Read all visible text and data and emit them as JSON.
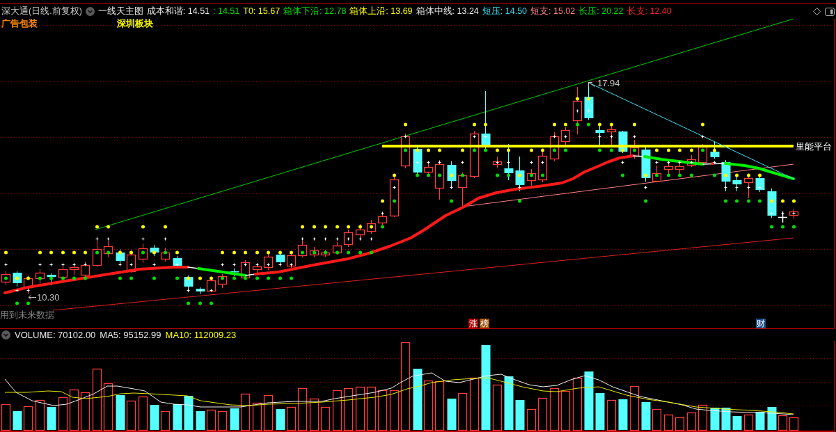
{
  "header": {
    "title": "深大通(日线.前复权)",
    "indicator": "一线天主图",
    "readings": [
      {
        "text": "成本和谐: 14.51",
        "color": "#e8e8e8"
      },
      {
        "text": ": 14.51",
        "color": "#00e000"
      },
      {
        "text": "T0: 15.67",
        "color": "#ffff00"
      },
      {
        "text": "箱体下沿: 12.78",
        "color": "#00e000"
      },
      {
        "text": "箱体上沿: 13.69",
        "color": "#ffff00"
      },
      {
        "text": "箱体中线: 13.24",
        "color": "#e8e8e8"
      },
      {
        "text": "短压: 14.50",
        "color": "#33ddee"
      },
      {
        "text": "短支: 15.02",
        "color": "#ff8080"
      },
      {
        "text": "长压: 20.22",
        "color": "#00e000"
      },
      {
        "text": "长支: 12.40",
        "color": "#ff2020"
      }
    ]
  },
  "price_chart": {
    "tags": [
      {
        "text": "广告包装",
        "color": "#ff8c00"
      },
      {
        "text": "深圳板块",
        "color": "#ffff00"
      }
    ],
    "high_label": "17.94",
    "low_label": "10.30",
    "platform_label": "里能平台",
    "note": "用到未来数据",
    "event_markers": [
      {
        "text": "涨",
        "color": "#b00000"
      },
      {
        "text": "榜",
        "color": "#a0520a"
      },
      {
        "text": "财",
        "color": "#1d4e89"
      }
    ]
  },
  "volume_panel": {
    "readings": [
      {
        "text": "VOLUME: 70102.00",
        "color": "#e8e8e8"
      },
      {
        "text": "MA5: 95152.99",
        "color": "#e8e8e8"
      },
      {
        "text": "MA10: 112009.23",
        "color": "#ffff00"
      }
    ]
  }
}
